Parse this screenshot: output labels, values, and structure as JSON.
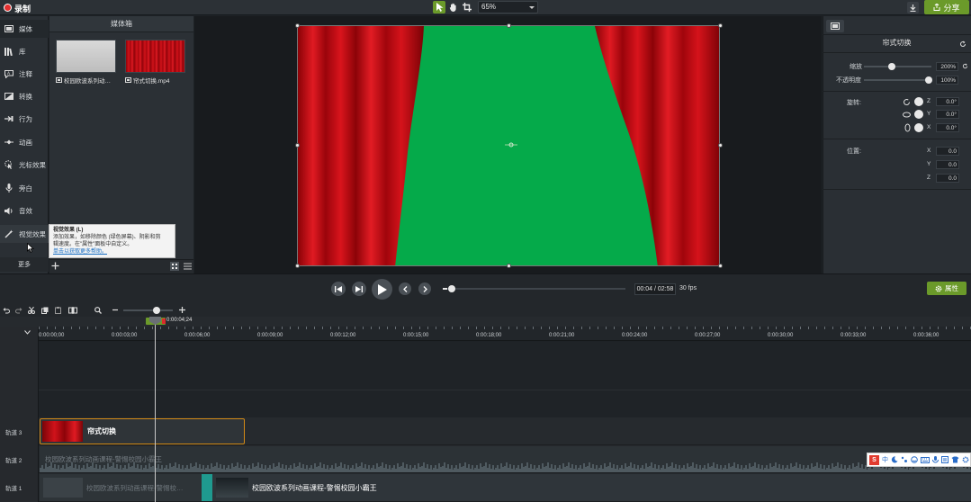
{
  "app": {
    "record_label": "录制",
    "zoom": "65%",
    "share_label": "分享"
  },
  "sidebar": {
    "items": [
      {
        "label": "媒体",
        "icon": "media-icon"
      },
      {
        "label": "库",
        "icon": "library-icon"
      },
      {
        "label": "注释",
        "icon": "annotation-icon"
      },
      {
        "label": "转换",
        "icon": "transition-icon"
      },
      {
        "label": "行为",
        "icon": "behavior-icon"
      },
      {
        "label": "动画",
        "icon": "animation-icon"
      },
      {
        "label": "光标效果",
        "icon": "cursor-effect-icon"
      },
      {
        "label": "旁白",
        "icon": "narration-icon"
      },
      {
        "label": "音效",
        "icon": "audio-effect-icon"
      },
      {
        "label": "视觉效果",
        "icon": "visual-effect-icon"
      }
    ],
    "more_label": "更多"
  },
  "bin": {
    "title": "媒体箱",
    "items": [
      {
        "caption": "校园欧波系列动…"
      },
      {
        "caption": "帘式切换.mp4"
      }
    ]
  },
  "tooltip": {
    "title": "视觉效果 (L)",
    "line1": "添加效果，如移除颜色 (绿色屏幕)、阴影和剪",
    "line2": "辑速度。在\"属性\"面板中自定义。",
    "link": "单击以获取更多帮助。"
  },
  "props": {
    "title": "帘式切换",
    "scale_label": "缩放",
    "scale_value": "200%",
    "opacity_label": "不透明度",
    "opacity_value": "100%",
    "rotation_label": "旋转:",
    "rot_z": "0.0°",
    "rot_y": "0.0°",
    "rot_x": "0.0°",
    "position_label": "位置:",
    "pos_x": "0.0",
    "pos_y": "0.0",
    "pos_z": "0.0",
    "axis_z": "Z",
    "axis_y": "Y",
    "axis_x": "X"
  },
  "playback": {
    "time": "00:04 / 02:58",
    "fps": "30 fps",
    "attr_label": "属性"
  },
  "timeline": {
    "playhead_time": "0:00:04;24",
    "ticks": [
      "0:00:00;00",
      "0:00:03;00",
      "0:00:06;00",
      "0:00:09;00",
      "0:00:12;00",
      "0:00:15;00",
      "0:00:18;00",
      "0:00:21;00",
      "0:00:24;00",
      "0:00:27;00",
      "0:00:30;00",
      "0:00:33;00",
      "0:00:36;00"
    ],
    "tracks": [
      {
        "label": "轨道 3",
        "clip": "帘式切换"
      },
      {
        "label": "轨道 2",
        "clip": "校园欧波系列动画课程-警惕校园小霸王"
      },
      {
        "label": "轨道 1",
        "clip_a": "校园欧波系列动画课程-警惕校…",
        "clip_b": "校园欧波系列动画课程-警惕校园小霸王"
      }
    ]
  },
  "ime": {
    "brand": "S",
    "mode": "中"
  },
  "colors": {
    "accent_green": "#6b9a2a",
    "record_red": "#e42f2f",
    "stage_green": "#05aa4a",
    "curtain_red": "#c8101a",
    "clip_border": "#d28a16"
  }
}
